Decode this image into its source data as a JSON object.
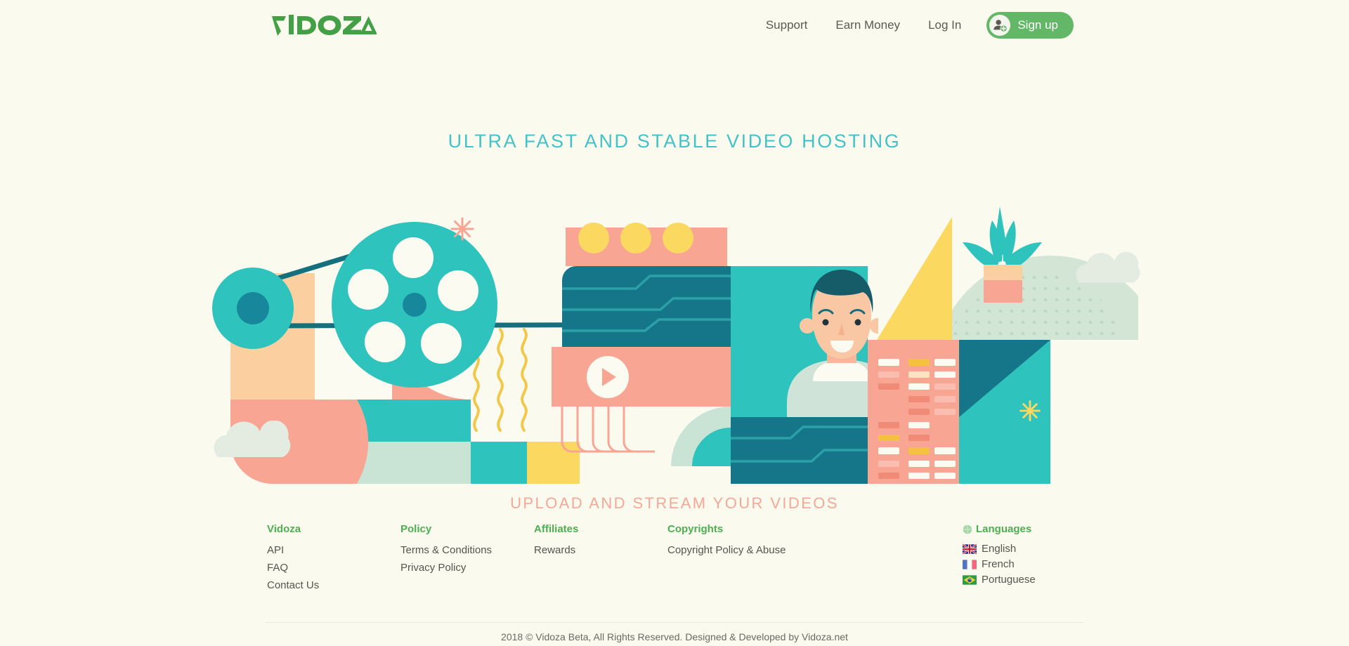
{
  "brand": {
    "logo_text": "VIDOZA",
    "logo_color": "#43a047"
  },
  "header": {
    "nav": [
      {
        "label": "Support",
        "name": "nav-support"
      },
      {
        "label": "Earn Money",
        "name": "nav-earn-money"
      },
      {
        "label": "Log In",
        "name": "nav-log-in"
      }
    ],
    "signup": {
      "label": "Sign up",
      "icon": "user-add-icon",
      "bg_color": "#62b866"
    }
  },
  "hero": {
    "title": "ULTRA FAST AND STABLE VIDEO HOSTING",
    "title_color": "#45c2c6",
    "subtitle": "UPLOAD AND STREAM YOUR VIDEOS",
    "subtitle_color": "#f7a796",
    "illustration": {
      "name": "video-hosting-illustration",
      "elements": [
        "film-reel-large",
        "film-reel-small",
        "play-button",
        "person-avatar",
        "potted-plant",
        "circuit-panels",
        "data-bars-panel",
        "cloud-left",
        "cloud-right",
        "sparkle-pink",
        "sparkle-yellow"
      ]
    }
  },
  "footer": {
    "columns": [
      {
        "heading": "Vidoza",
        "links": [
          "API",
          "FAQ",
          "Contact Us"
        ]
      },
      {
        "heading": "Policy",
        "links": [
          "Terms & Conditions",
          "Privacy Policy"
        ]
      },
      {
        "heading": "Affiliates",
        "links": [
          "Rewards"
        ]
      },
      {
        "heading": "Copyrights",
        "links": [
          "Copyright Policy & Abuse"
        ]
      }
    ],
    "languages": {
      "heading": "Languages",
      "icon": "globe-icon",
      "items": [
        {
          "label": "English",
          "flag": "uk-flag-icon"
        },
        {
          "label": "French",
          "flag": "france-flag-icon"
        },
        {
          "label": "Portuguese",
          "flag": "brazil-flag-icon"
        }
      ]
    },
    "copyright": "2018 © Vidoza Beta, All Rights Reserved. Designed & Developed by Vidoza.net"
  },
  "colors": {
    "page_background": "#FAFAEF",
    "brand_green": "#4caf50",
    "teal": "#45c2c6",
    "dark_teal": "#117a87",
    "salmon": "#f9a593",
    "peach": "#fbcfa0",
    "mint": "#c9e4d5",
    "yellow": "#fbd85f"
  }
}
